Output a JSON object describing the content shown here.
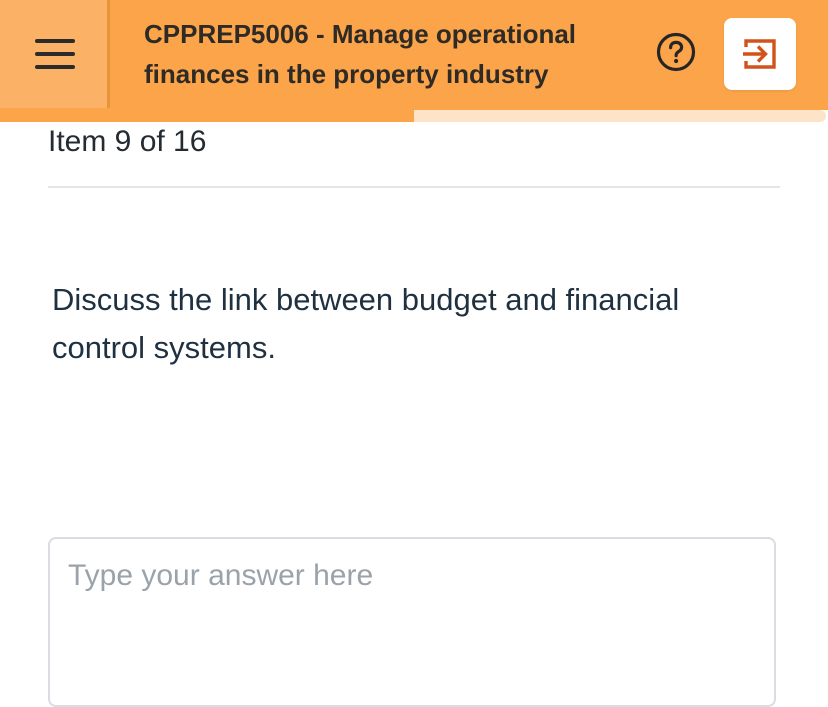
{
  "header": {
    "course_title": "CPPREP5006 - Manage operational finances in the property industry",
    "menu_icon": "hamburger-menu-icon",
    "help_icon": "question-circle-icon",
    "exit_icon": "exit-arrow-icon",
    "colors": {
      "header_bg": "#fba44a",
      "menu_bg": "#fbb267",
      "exit_icon": "#d2521b"
    }
  },
  "progress": {
    "fraction": 0.5,
    "fill_color": "#fba44a",
    "track_color": "#fde3c7"
  },
  "item": {
    "counter": "Item 9 of 16"
  },
  "question": {
    "text": "Discuss the link between budget and financial control systems."
  },
  "answer": {
    "placeholder": "Type your answer here",
    "value": ""
  }
}
